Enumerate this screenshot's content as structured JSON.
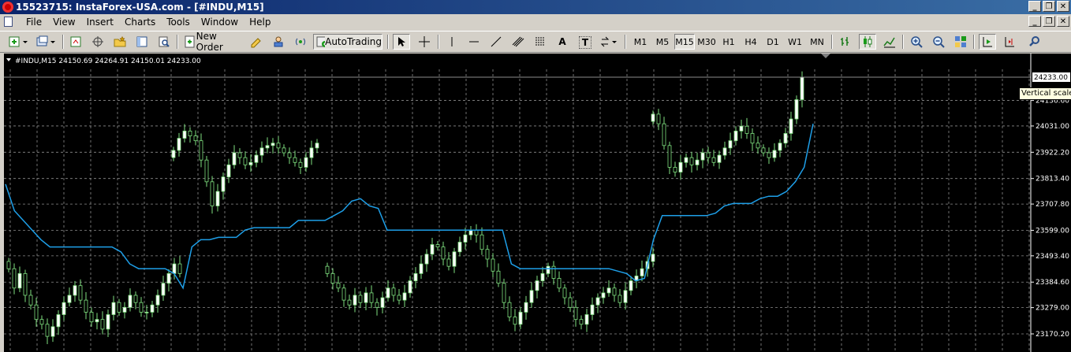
{
  "window": {
    "title": "15523715: InstaForex-USA.com - [#INDU,M15]",
    "minimize": "_",
    "restore": "❐",
    "close": "✕"
  },
  "menu": {
    "items": [
      "File",
      "View",
      "Insert",
      "Charts",
      "Tools",
      "Window",
      "Help"
    ]
  },
  "toolbar": {
    "new_order": "New Order",
    "autotrading": "AutoTrading",
    "timeframes": [
      "M1",
      "M5",
      "M15",
      "M30",
      "H1",
      "H4",
      "D1",
      "W1",
      "MN"
    ],
    "active_timeframe": "M15",
    "text_tool": "A",
    "label_tool": "T"
  },
  "chart": {
    "header": "#INDU,M15  24150.69 24264.91 24150.01 24233.00",
    "current_price_label": "24233.00",
    "tooltip": "Vertical scale",
    "price_ticks": [
      "24136.60",
      "24031.00",
      "23922.20",
      "23813.40",
      "23707.80",
      "23599.00",
      "23493.40",
      "23384.60",
      "23279.00",
      "23170.20"
    ],
    "colors": {
      "background": "#000000",
      "grid": "#8c8c8c",
      "bull_candle": "#ffffff",
      "bear_candle": "#000000",
      "candle_outline": "#7fe07f",
      "indicator": "#1e9fe8",
      "price_line": "#8c8c8c",
      "axis_text": "#ffffff"
    }
  },
  "chart_data": {
    "type": "candlestick",
    "title": "#INDU,M15",
    "last_bar": {
      "open": 24150.69,
      "high": 24264.91,
      "low": 24150.01,
      "close": 24233.0
    },
    "ylim": [
      23130,
      24320
    ],
    "grid": true,
    "y_ticks": [
      24136.6,
      24031.0,
      23922.2,
      23813.4,
      23707.8,
      23599.0,
      23493.4,
      23384.6,
      23279.0,
      23170.2
    ],
    "candle_segments": [
      {
        "start_close": 23440,
        "closes": [
          23440,
          23360,
          23420,
          23330,
          23290,
          23230,
          23210,
          23160,
          23200,
          23250,
          23300,
          23330,
          23370,
          23310,
          23260,
          23220,
          23230,
          23190,
          23250,
          23300,
          23260,
          23280,
          23330,
          23300,
          23260,
          23260,
          23290,
          23330,
          23380,
          23420,
          23460,
          23420
        ]
      },
      {
        "start_close": 23930,
        "closes": [
          23930,
          23980,
          24010,
          23990,
          23970,
          23890,
          23800,
          23700,
          23760,
          23820,
          23870,
          23920,
          23900,
          23870,
          23880,
          23910,
          23940,
          23950,
          23960,
          23940,
          23920,
          23900,
          23880,
          23860,
          23900,
          23940,
          23960
        ]
      },
      {
        "start_close": 23420,
        "closes": [
          23420,
          23380,
          23360,
          23310,
          23290,
          23330,
          23300,
          23340,
          23300,
          23280,
          23320,
          23360,
          23330,
          23310,
          23340,
          23390,
          23420,
          23460,
          23500,
          23540,
          23530,
          23480,
          23450,
          23510,
          23550,
          23580,
          23600,
          23580,
          23520,
          23480,
          23430,
          23380,
          23300,
          23240,
          23210,
          23260,
          23300,
          23350,
          23390,
          23420,
          23450,
          23400,
          23360,
          23320,
          23280,
          23230,
          23210,
          23250,
          23290,
          23320,
          23340,
          23360,
          23330,
          23300,
          23350,
          23390,
          23410,
          23440,
          23470,
          23500
        ]
      },
      {
        "start_close": 24080,
        "closes": [
          24080,
          24040,
          23950,
          23860,
          23840,
          23880,
          23900,
          23870,
          23890,
          23920,
          23900,
          23880,
          23910,
          23940,
          23970,
          24010,
          24030,
          24000,
          23960,
          23940,
          23920,
          23900,
          23930,
          23960,
          24000,
          24060,
          24140,
          24233
        ]
      }
    ],
    "indicator_series": {
      "name": "",
      "y": [
        23790,
        23680,
        23640,
        23600,
        23560,
        23530,
        23530,
        23530,
        23530,
        23530,
        23530,
        23530,
        23530,
        23510,
        23460,
        23440,
        23440,
        23440,
        23440,
        23420,
        23360,
        23530,
        23560,
        23560,
        23570,
        23570,
        23570,
        23600,
        23610,
        23610,
        23610,
        23610,
        23610,
        23640,
        23640,
        23640,
        23640,
        23660,
        23680,
        23720,
        23730,
        23700,
        23690,
        23600,
        23600,
        23600,
        23600,
        23600,
        23600,
        23600,
        23600,
        23600,
        23600,
        23600,
        23600,
        23600,
        23600,
        23460,
        23440,
        23440,
        23440,
        23440,
        23440,
        23440,
        23440,
        23440,
        23440,
        23440,
        23440,
        23430,
        23420,
        23390,
        23400,
        23560,
        23660,
        23660,
        23660,
        23660,
        23660,
        23660,
        23670,
        23700,
        23710,
        23710,
        23710,
        23730,
        23740,
        23740,
        23760,
        23800,
        23860,
        24040
      ]
    }
  }
}
